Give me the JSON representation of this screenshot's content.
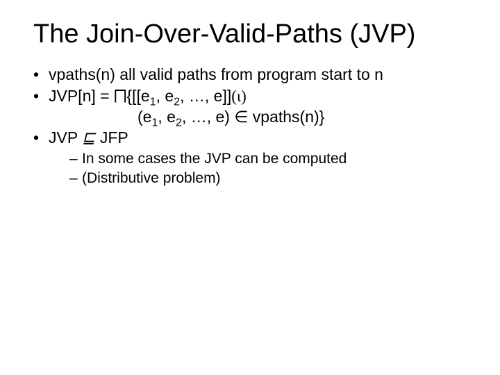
{
  "title": "The Join-Over-Valid-Paths (JVP)",
  "bullets": {
    "b1": "vpaths(n) all valid paths from program start to n",
    "b2_lead": "JVP[n]  = ",
    "b2_sym": "⨅",
    "b2_rest_a": "{[[e",
    "b2_s1": "1",
    "b2_rest_b": ", e",
    "b2_s2": "2",
    "b2_rest_c": ", …, e]]",
    "b2_iota": "(ι)",
    "b2_line2_a": "(e",
    "b2_l2s1": "1",
    "b2_line2_b": ", e",
    "b2_l2s2": "2",
    "b2_line2_c": ", …, e) ",
    "b2_in": "∈",
    "b2_line2_d": " vpaths(n)}",
    "b3_a": "JVP ",
    "b3_rel": "⊑",
    "b3_b": " JFP",
    "sub1": "In some cases the JVP can be computed",
    "sub2": "(Distributive problem)"
  }
}
